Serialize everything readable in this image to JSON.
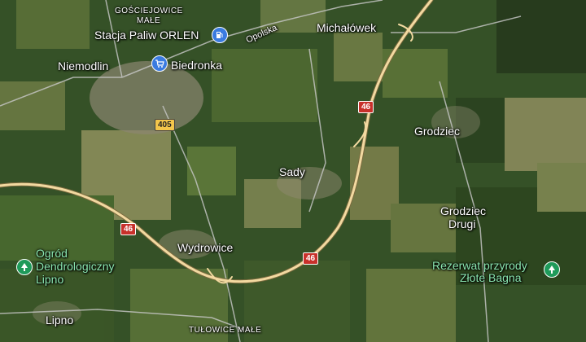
{
  "map": {
    "places": {
      "gosciejowice": "GOŚCIEJOWICE",
      "male": "MAŁE",
      "michalowek": "Michałówek",
      "niemodlin": "Niemodlin",
      "grodziec": "Grodziec",
      "sady": "Sady",
      "grodziec_drugi_1": "Grodziec",
      "grodziec_drugi_2": "Drugi",
      "wydrowice": "Wydrowice",
      "lipno": "Lipno",
      "tulowice_male": "TUŁOWICE MAŁE"
    },
    "streets": {
      "opolska": "Opolska"
    },
    "pois": {
      "orlen": "Stacja Paliw ORLEN",
      "biedronka": "Biedronka",
      "ogrod_1": "Ogród",
      "ogrod_2": "Dendrologiczny",
      "ogrod_3": "Lipno",
      "rezerwat_1": "Rezerwat przyrody",
      "rezerwat_2": "Złote Bagna"
    },
    "road_shields": {
      "r46_a": "46",
      "r46_b": "46",
      "r46_c": "46",
      "r405": "405"
    },
    "icons": {
      "orlen": "fuel-station-icon",
      "biedronka": "shopping-cart-icon",
      "ogrod": "tree-icon",
      "rezerwat": "tree-icon"
    },
    "colors": {
      "highway": "#f2d9a0",
      "road": "#c9c9c9",
      "poi_blue": "#3a7be0",
      "poi_green": "#1f9a5a",
      "green_label": "#8be7b0",
      "shield_red": "#c8312b",
      "shield_yellow": "#f3c64b"
    }
  }
}
